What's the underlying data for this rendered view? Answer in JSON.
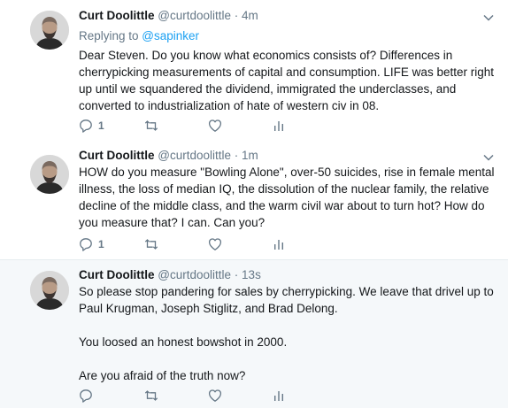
{
  "tweets": [
    {
      "name": "Curt Doolittle",
      "handle": "@curtdoolittle",
      "separator": "·",
      "time": "4m",
      "replying_prefix": "Replying to ",
      "replying_to": "@sapinker",
      "paragraphs": [
        "Dear Steven. Do you know what economics consists of? Differences in cherrypicking measurements of capital and consumption.  LIFE was better right up until we squandered the dividend, immigrated the underclasses, and converted to industrialization of hate of western civ in 08."
      ],
      "reply_count": "1"
    },
    {
      "name": "Curt Doolittle",
      "handle": "@curtdoolittle",
      "separator": "·",
      "time": "1m",
      "paragraphs": [
        "HOW do you measure \"Bowling Alone\", over-50 suicides, rise in female mental illness, the loss of median IQ, the dissolution of the nuclear family, the relative decline of the middle class, and the warm civil war about to turn hot?  How do you measure that?  I can.  Can you?"
      ],
      "reply_count": "1"
    },
    {
      "name": "Curt Doolittle",
      "handle": "@curtdoolittle",
      "separator": "·",
      "time": "13s",
      "paragraphs": [
        "So please stop pandering for sales by cherrypicking. We leave that drivel up to Paul Krugman, Joseph Stiglitz, and Brad Delong.",
        "You loosed an honest bowshot in 2000.",
        "Are you afraid of the truth now?"
      ],
      "reply_count": ""
    }
  ],
  "icons": {
    "reply": "reply-icon",
    "retweet": "retweet-icon",
    "like": "heart-icon",
    "stats": "analytics-icon",
    "more": "chevron-down-icon"
  },
  "colors": {
    "link": "#1da1f2",
    "secondary_text": "#657786",
    "thread_line": "#ccd6dd",
    "highlight_bg": "#f5f8fa"
  }
}
